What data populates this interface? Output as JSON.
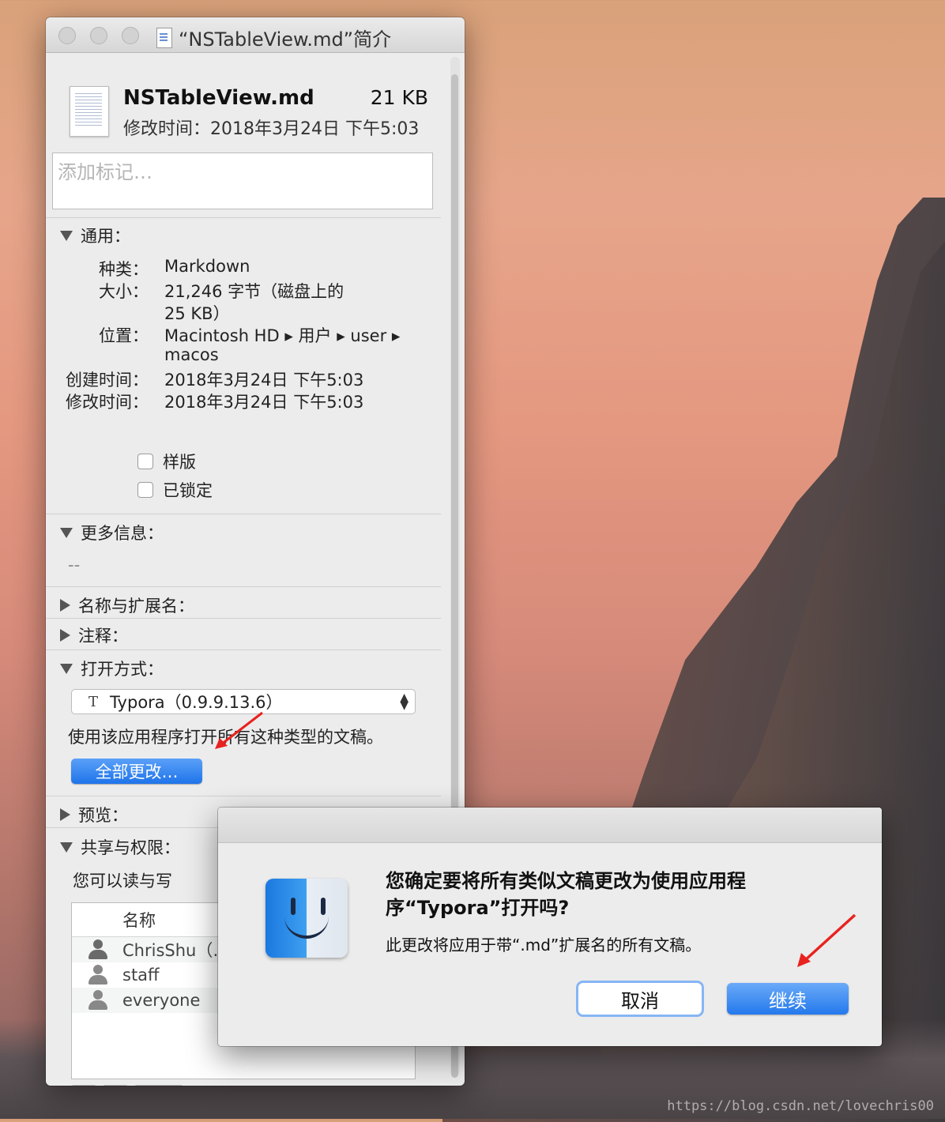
{
  "window": {
    "title": "“NSTableView.md”简介"
  },
  "file": {
    "name": "NSTableView.md",
    "size": "21 KB",
    "modified": "修改时间：2018年3月24日 下午5:03",
    "tags_placeholder": "添加标记…"
  },
  "general": {
    "header": "通用：",
    "kind_label": "种类：",
    "kind_value": "Markdown",
    "size_label": "大小：",
    "size_value_1": "21,246 字节（磁盘上的",
    "size_value_2": "25 KB）",
    "where_label": "位置：",
    "where_value_1": "Macintosh HD ▸ 用户 ▸ user ▸",
    "where_value_2": "macos",
    "created_label": "创建时间：",
    "created_value": "2018年3月24日 下午5:03",
    "modified_label": "修改时间：",
    "modified_value": "2018年3月24日 下午5:03",
    "stationery": "样版",
    "locked": "已锁定"
  },
  "more_info": {
    "header": "更多信息：",
    "value": "--"
  },
  "sections": {
    "name_ext": "名称与扩展名：",
    "comments": "注释：",
    "open_with": "打开方式：",
    "preview": "预览：",
    "sharing": "共享与权限："
  },
  "open_with": {
    "app": "Typora（0.9.9.13.6）",
    "app_icon": "T",
    "hint": "使用该应用程序打开所有这种类型的文稿。",
    "change_all": "全部更改…"
  },
  "sharing": {
    "status": "您可以读与写",
    "col_name": "名称",
    "rows": [
      "ChrisShu（…",
      "staff",
      "everyone"
    ]
  },
  "dialog": {
    "title": "您确定要将所有类似文稿更改为使用应用程序“Typora”打开吗?",
    "message": "此更改将应用于带“.md”扩展名的所有文稿。",
    "cancel": "取消",
    "continue": "继续"
  },
  "watermark": "https://blog.csdn.net/lovechris00",
  "colors": {
    "accent": "#2479ed",
    "arrow": "#e8231f"
  }
}
